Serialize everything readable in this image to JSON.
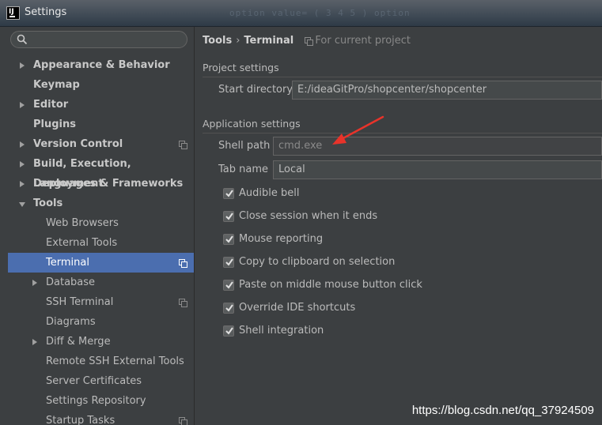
{
  "window": {
    "title": "Settings",
    "blurred_text": "option value= ( 3 4 5 ) option"
  },
  "sidebar": {
    "search_placeholder": "",
    "items": [
      {
        "label": "Appearance & Behavior",
        "bold": true,
        "expand": "right"
      },
      {
        "label": "Keymap",
        "bold": true,
        "expand": "none"
      },
      {
        "label": "Editor",
        "bold": true,
        "expand": "right"
      },
      {
        "label": "Plugins",
        "bold": true,
        "expand": "none"
      },
      {
        "label": "Version Control",
        "bold": true,
        "expand": "right",
        "project_icon": true
      },
      {
        "label": "Build, Execution, Deployment",
        "bold": true,
        "expand": "right"
      },
      {
        "label": "Languages & Frameworks",
        "bold": true,
        "expand": "right"
      },
      {
        "label": "Tools",
        "bold": true,
        "expand": "down"
      },
      {
        "label": "Web Browsers",
        "bold": false,
        "expand": "none"
      },
      {
        "label": "External Tools",
        "bold": false,
        "expand": "none"
      },
      {
        "label": "Terminal",
        "bold": false,
        "expand": "none",
        "selected": true,
        "project_icon": true
      },
      {
        "label": "Database",
        "bold": false,
        "expand": "right"
      },
      {
        "label": "SSH Terminal",
        "bold": false,
        "expand": "none",
        "project_icon": true
      },
      {
        "label": "Diagrams",
        "bold": false,
        "expand": "none"
      },
      {
        "label": "Diff & Merge",
        "bold": false,
        "expand": "right"
      },
      {
        "label": "Remote SSH External Tools",
        "bold": false,
        "expand": "none"
      },
      {
        "label": "Server Certificates",
        "bold": false,
        "expand": "none"
      },
      {
        "label": "Settings Repository",
        "bold": false,
        "expand": "none"
      },
      {
        "label": "Startup Tasks",
        "bold": false,
        "expand": "none",
        "project_icon": true
      }
    ]
  },
  "breadcrumb": {
    "part1": "Tools",
    "separator": "›",
    "part2": "Terminal",
    "scope": "For current project"
  },
  "project_settings": {
    "title": "Project settings",
    "start_directory_label": "Start directory",
    "start_directory_value": "E:/ideaGitPro/shopcenter/shopcenter"
  },
  "application_settings": {
    "title": "Application settings",
    "shell_path_label": "Shell path",
    "shell_path_value": "cmd.exe",
    "tab_name_label": "Tab name",
    "tab_name_value": "Local"
  },
  "checkboxes": [
    {
      "label": "Audible bell",
      "checked": true
    },
    {
      "label": "Close session when it ends",
      "checked": true
    },
    {
      "label": "Mouse reporting",
      "checked": true
    },
    {
      "label": "Copy to clipboard on selection",
      "checked": true
    },
    {
      "label": "Paste on middle mouse button click",
      "checked": true
    },
    {
      "label": "Override IDE shortcuts",
      "checked": true
    },
    {
      "label": "Shell integration",
      "checked": true
    }
  ],
  "watermark": "https://blog.csdn.net/qq_37924509",
  "colors": {
    "selection": "#4b6eaf",
    "annotation_arrow": "#e8332a",
    "background": "#3c3f41"
  }
}
